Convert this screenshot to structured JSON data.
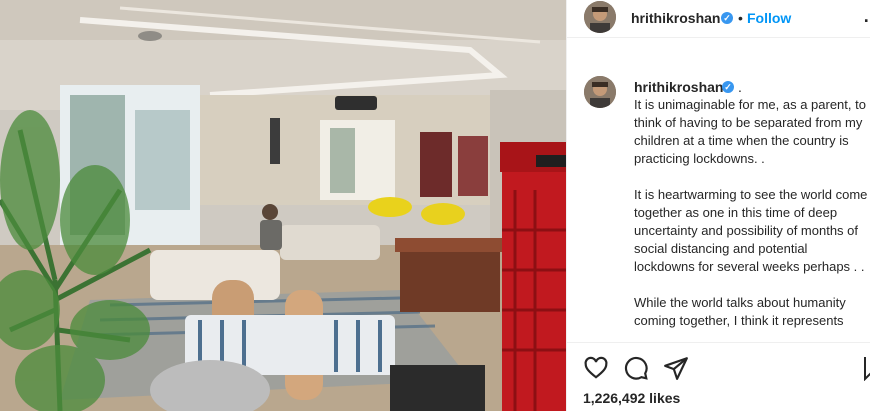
{
  "header": {
    "username": "hrithikroshan",
    "follow_label": "Follow",
    "separator": "•",
    "more_label": "…",
    "verified_glyph": "✓"
  },
  "caption": {
    "username": "hrithikroshan",
    "after_name": ".",
    "paragraphs": [
      "It is unimaginable for me, as a parent, to think of having to be separated from my children at a time when the country is practicing lockdowns. .",
      "It is heartwarming to see the world come together as one in this time of deep uncertainty and possibility of months of social distancing and potential lockdowns for several weeks perhaps . .",
      "While the world talks about humanity coming together, I think it represents"
    ]
  },
  "actions": {
    "icons": [
      "heart-icon",
      "comment-icon",
      "share-icon",
      "bookmark-icon"
    ],
    "likes": "1,226,492 likes"
  },
  "colors": {
    "accent": "#0095f6",
    "verified": "#3897f0",
    "text": "#262626",
    "divider": "#efefef"
  }
}
